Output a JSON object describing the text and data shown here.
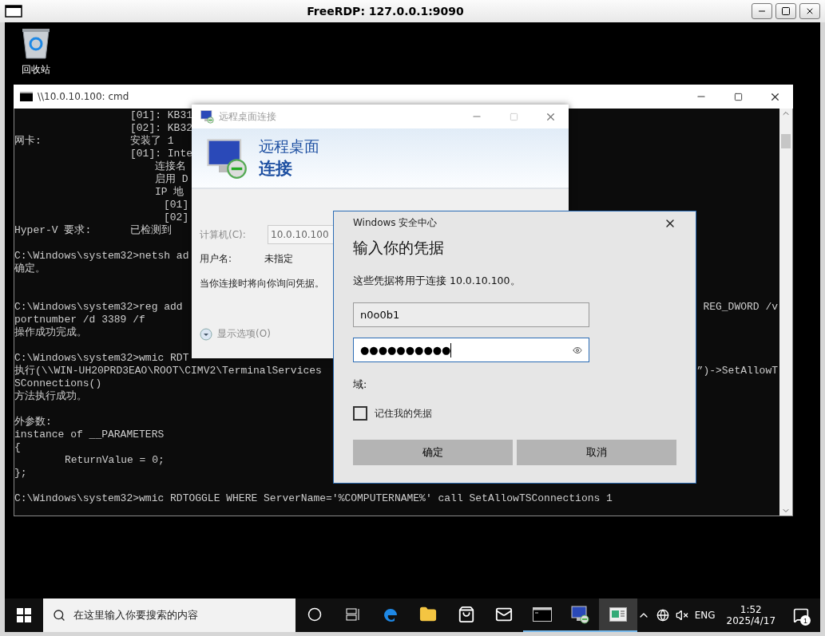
{
  "frame": {
    "title": "FreeRDP: 127.0.0.1:9090"
  },
  "desktop_icons": [
    {
      "label": "回收站"
    }
  ],
  "cmd_window": {
    "title": "\\\\10.0.10.100: cmd",
    "lines": [
      {
        "kind": "item",
        "text": "[01]: KB31"
      },
      {
        "kind": "item",
        "text": "[02]: KB32"
      },
      {
        "kind": "label",
        "label": "网卡:",
        "text": "安装了 1"
      },
      {
        "kind": "item",
        "text": "[01]: Inte"
      },
      {
        "kind": "sub",
        "text": "连接名"
      },
      {
        "kind": "sub",
        "text": "启用 D"
      },
      {
        "kind": "sub",
        "text": "IP 地"
      },
      {
        "kind": "subsub",
        "text": "[01]"
      },
      {
        "kind": "subsub",
        "text": "[02]"
      },
      {
        "kind": "label",
        "label": "Hyper-V 要求:",
        "text": "已检测到"
      },
      {
        "kind": "blank"
      },
      {
        "kind": "plain",
        "text": "C:\\Windows\\system32>netsh ad"
      },
      {
        "kind": "plain",
        "text": "确定。"
      },
      {
        "kind": "blank"
      },
      {
        "kind": "blank"
      },
      {
        "kind": "plain",
        "text": "C:\\Windows\\system32>reg add",
        "tail": "REG_DWORD /v"
      },
      {
        "kind": "plain",
        "text": "portnumber /d 3389 /f"
      },
      {
        "kind": "plain",
        "text": "操作成功完成。"
      },
      {
        "kind": "blank"
      },
      {
        "kind": "plain",
        "text": "C:\\Windows\\system32>wmic RDT"
      },
      {
        "kind": "plain",
        "text": "执行(\\\\WIN-UH20PRD3EAO\\ROOT\\CIMV2\\TerminalServices",
        "tail": "”)->SetAllowT"
      },
      {
        "kind": "plain",
        "text": "SConnections()"
      },
      {
        "kind": "plain",
        "text": "方法执行成功。"
      },
      {
        "kind": "blank"
      },
      {
        "kind": "plain",
        "text": "外参数:"
      },
      {
        "kind": "plain",
        "text": "instance of __PARAMETERS"
      },
      {
        "kind": "plain",
        "text": "{"
      },
      {
        "kind": "code",
        "text": "ReturnValue = 0;"
      },
      {
        "kind": "plain",
        "text": "};"
      },
      {
        "kind": "blank"
      },
      {
        "kind": "plain",
        "text": "C:\\Windows\\system32>wmic RDTOGGLE WHERE ServerName='%COMPUTERNAME%' call SetAllowTSConnections 1"
      }
    ]
  },
  "rdp_dialog": {
    "title": "远程桌面连接",
    "heading_top": "远程桌面",
    "heading_bottom": "连接",
    "computer_label": "计算机(C):",
    "computer_value": "10.0.10.100",
    "user_label": "用户名:",
    "user_value": "未指定",
    "note": "当你连接时将向你询问凭据。",
    "options_link": "显示选项(O)"
  },
  "credential_dialog": {
    "app": "Windows 安全中心",
    "title": "输入你的凭据",
    "message": "这些凭据将用于连接 10.0.10.100。",
    "username": {
      "value": "n0o0b1"
    },
    "password": {
      "value": "●●●●●●●●●●"
    },
    "domain_label": "域:",
    "remember": {
      "label": "记住我的凭据",
      "checked": false
    },
    "buttons": [
      {
        "label": "确定"
      },
      {
        "label": "取消"
      }
    ]
  },
  "taskbar": {
    "search": {
      "placeholder": "在这里输入你要搜索的内容"
    },
    "apps": [
      {
        "kind": "cortana",
        "running": false,
        "selected": false
      },
      {
        "kind": "taskview",
        "running": false,
        "selected": false
      },
      {
        "kind": "edge",
        "running": false,
        "selected": false
      },
      {
        "kind": "explorer",
        "running": false,
        "selected": false
      },
      {
        "kind": "store",
        "running": false,
        "selected": false
      },
      {
        "kind": "mail",
        "running": false,
        "selected": false
      },
      {
        "kind": "console",
        "running": true,
        "selected": false
      },
      {
        "kind": "remote",
        "running": true,
        "selected": false
      },
      {
        "kind": "window",
        "running": true,
        "selected": true
      }
    ],
    "language": "ENG",
    "time": "1:52",
    "date": "2025/4/17",
    "notification_count": "1"
  }
}
